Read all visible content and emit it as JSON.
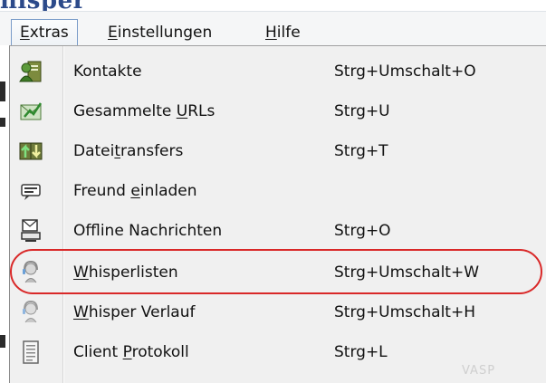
{
  "window_title": "hisper",
  "menubar": {
    "items": [
      {
        "label_underlined": "E",
        "label_rest": "xtras",
        "active": true
      },
      {
        "label_underlined": "E",
        "label_rest": "instellungen",
        "active": false
      },
      {
        "label_underlined": "H",
        "label_rest": "ilfe",
        "active": false
      }
    ]
  },
  "menu": {
    "items": [
      {
        "pre": "Kontakte",
        "u": "",
        "post": "",
        "shortcut": "Strg+Umschalt+O",
        "icon": "contacts-icon"
      },
      {
        "pre": "Gesammelte ",
        "u": "U",
        "post": "RLs",
        "shortcut": "Strg+U",
        "icon": "collected-urls-icon"
      },
      {
        "pre": "Datei",
        "u": "t",
        "post": "ransfers",
        "shortcut": "Strg+T",
        "icon": "file-transfer-icon"
      },
      {
        "pre": "Freund ",
        "u": "e",
        "post": "inladen",
        "shortcut": "",
        "icon": "invite-friend-icon"
      },
      {
        "pre": "Offline Nachrichten",
        "u": "",
        "post": "",
        "shortcut": "Strg+O",
        "icon": "offline-messages-icon"
      },
      {
        "pre": "",
        "u": "W",
        "post": "hisperlisten",
        "shortcut": "Strg+Umschalt+W",
        "icon": "whisper-lists-icon"
      },
      {
        "pre": "",
        "u": "W",
        "post": "hisper Verlauf",
        "shortcut": "Strg+Umschalt+H",
        "icon": "whisper-history-icon"
      },
      {
        "pre": "Client ",
        "u": "P",
        "post": "rotokoll",
        "shortcut": "Strg+L",
        "icon": "client-log-icon"
      }
    ],
    "highlighted_index": 5
  },
  "colors": {
    "highlight_oval": "#d92828",
    "menu_bg": "#f0f0f0",
    "title": "#2c4a8a"
  }
}
